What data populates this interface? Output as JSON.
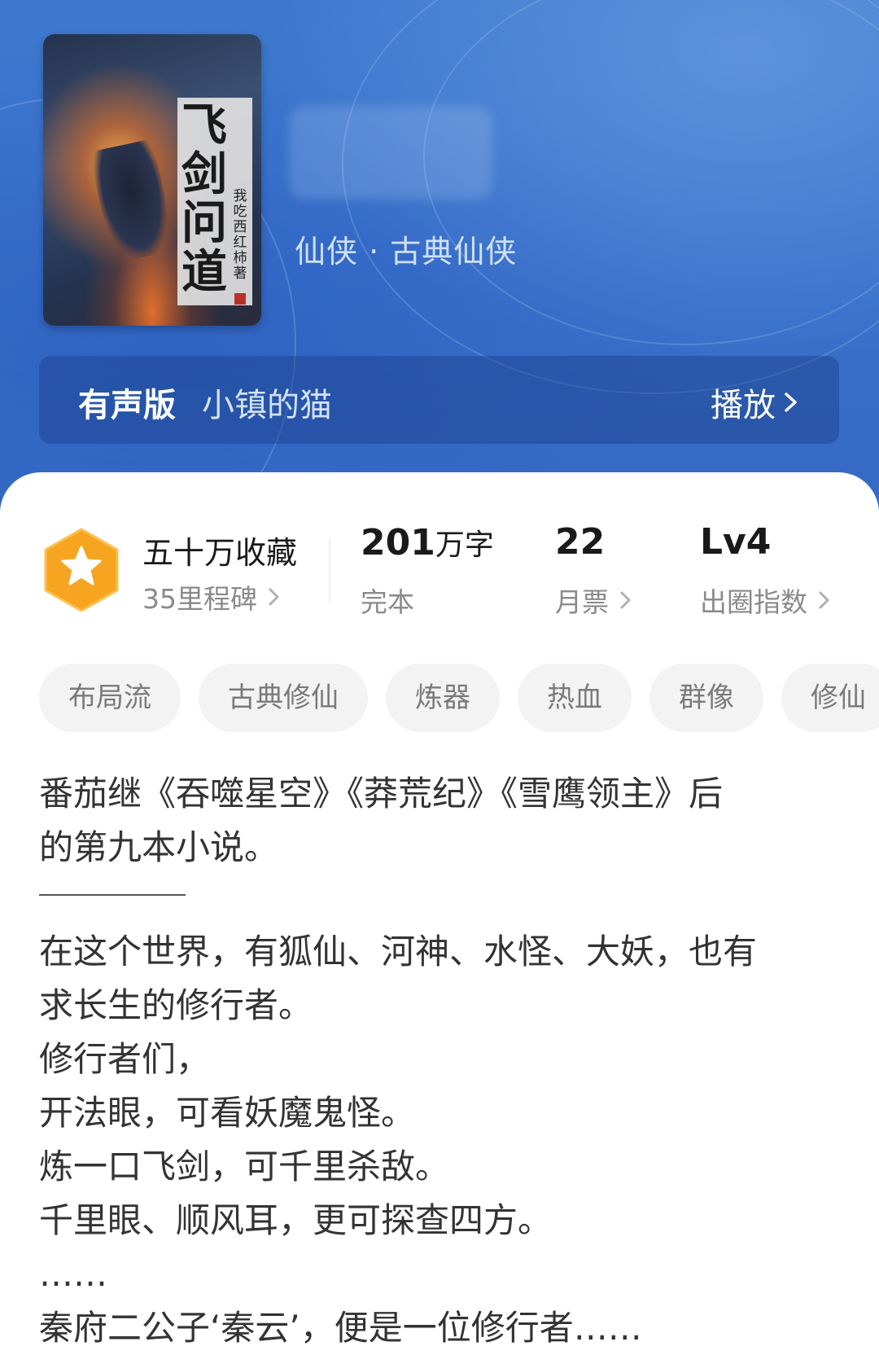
{
  "book": {
    "cover_title_lines": [
      "飞",
      "剑",
      "问",
      "道"
    ],
    "cover_author": "我吃西红柿",
    "cover_author_suffix": "著",
    "genre": "仙侠 · 古典仙侠"
  },
  "audio": {
    "label": "有声版",
    "narrator": "小镇的猫",
    "play_label": "播放"
  },
  "stats": {
    "collect_title": "五十万收藏",
    "collect_sub": "35里程碑",
    "words_value": "201",
    "words_unit": "万字",
    "words_sub": "完本",
    "tickets_value": "22",
    "tickets_sub": "月票",
    "level_value": "Lv4",
    "level_sub": "出圈指数"
  },
  "tags": [
    "布局流",
    "古典修仙",
    "炼器",
    "热血",
    "群像",
    "修仙"
  ],
  "description": {
    "intro_lines": [
      "番茄继《吞噬星空》《莽荒纪》《雪鹰领主》后",
      "的第九本小说。"
    ],
    "body_lines": [
      "在这个世界，有狐仙、河神、水怪、大妖，也有",
      "求长生的修行者。",
      "修行者们，",
      "开法眼，可看妖魔鬼怪。",
      "炼一口飞剑，可千里杀敌。",
      "千里眼、顺风耳，更可探查四方。",
      "……",
      "秦府二公子‘秦云’，便是一位修行者……"
    ]
  },
  "colors": {
    "header_blue": "#3a72cb",
    "badge_orange": "#f7a521",
    "tag_bg": "#f3f3f3"
  },
  "icons": {
    "play_chevron": "chevron-right-icon",
    "badge": "star-hexagon-icon"
  }
}
